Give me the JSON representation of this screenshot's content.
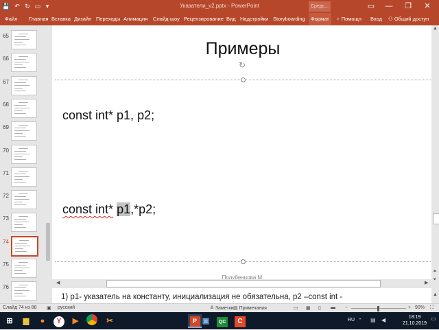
{
  "window": {
    "title": "Указатели_v2.pptx - PowerPoint",
    "search_placeholder": "Средс...",
    "colors": {
      "accent": "#b7472a",
      "selection": "#c5482a"
    },
    "controls": {
      "minimize": "—",
      "restore": "❐",
      "close": "✕",
      "ribbon_options": "▭"
    }
  },
  "ribbon": {
    "tabs": [
      "Файл",
      "Главная",
      "Вставка",
      "Дизайн",
      "Переходы",
      "Анимация",
      "Слайд-шоу",
      "Рецензирование",
      "Вид",
      "Надстройки",
      "Storyboarding",
      "Формат"
    ],
    "help": "Помощн",
    "signin": "Вход",
    "share": "Общий доступ"
  },
  "thumbnails": {
    "numbers": [
      "65",
      "66",
      "67",
      "68",
      "69",
      "70",
      "71",
      "72",
      "73",
      "74",
      "75",
      "76"
    ],
    "selected": "74"
  },
  "slide": {
    "title": "Примеры",
    "line1": "const int* p1, p2;",
    "line2_prefix": "const int*",
    "line2_p1": "p1",
    "line2_rest": ",*p2;",
    "footer": "Полубенцова М."
  },
  "notes": {
    "text": "1)   p1- указатель на константу, инициализация не обязательна, p2 –const int -"
  },
  "status": {
    "slide_info": "Слайд 74 из 88",
    "language": "русский",
    "notes_btn": "Заметки",
    "comments_btn": "Примечания",
    "zoom": "90%"
  },
  "taskbar": {
    "apps": [
      "Windows",
      "Explorer",
      "Firefox",
      "Yandex",
      "Media Player",
      "Chrome",
      "PowerPoint",
      "Steps Recorder",
      "QC",
      "Clipper"
    ],
    "keyboard_lang": "RU",
    "time": "18:19",
    "date": "21.10.2019"
  }
}
